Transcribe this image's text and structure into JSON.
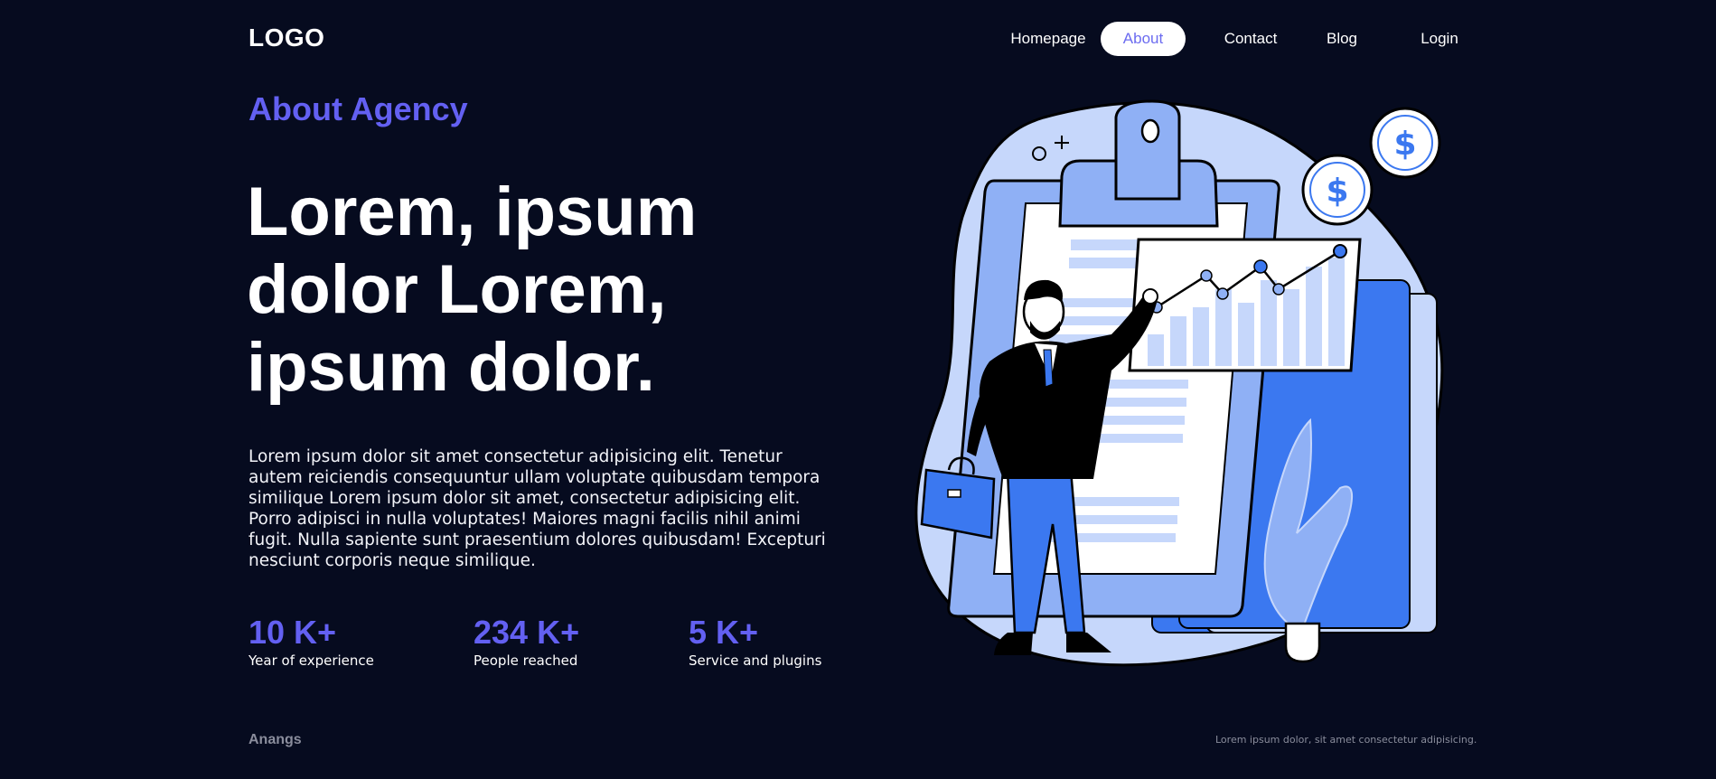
{
  "header": {
    "logo": "LOGO",
    "nav": [
      {
        "label": "Homepage",
        "active": false
      },
      {
        "label": "About",
        "active": true
      },
      {
        "label": "Contact",
        "active": false
      },
      {
        "label": "Blog",
        "active": false
      },
      {
        "label": "Login",
        "active": false
      }
    ]
  },
  "hero": {
    "eyebrow": "About Agency",
    "headline": {
      "line1": "Lorem, ipsum",
      "line2": "dolor Lorem,",
      "line3": "ipsum dolor."
    },
    "body": "Lorem ipsum dolor sit amet consectetur adipisicing elit. Tenetur autem reiciendis consequuntur ullam voluptate quibusdam tempora similique Lorem ipsum dolor sit amet, consectetur adipisicing elit. Porro adipisci in nulla voluptates! Maiores magni facilis nihil animi fugit. Nulla sapiente sunt praesentium dolores quibusdam! Excepturi nesciunt corporis neque similique."
  },
  "stats": [
    {
      "value": "10 K+",
      "label": "Year of experience"
    },
    {
      "value": "234 K+",
      "label": "People reached"
    },
    {
      "value": "5 K+",
      "label": "Service and plugins"
    }
  ],
  "illustration": {
    "icons": [
      "dollar-coin-icon",
      "dollar-coin-icon",
      "clipboard-icon",
      "growth-chart-icon",
      "businessman-icon",
      "briefcase-icon",
      "plant-icon",
      "sparkle-icon"
    ]
  },
  "footer": {
    "brand": "Anangs",
    "note": "Lorem ipsum dolor, sit amet consectetur adipisicing."
  },
  "colors": {
    "background": "#060b1f",
    "accent": "#6360f2",
    "illustration_blue": "#3b78f0",
    "illustration_light": "#c6d7fb"
  }
}
